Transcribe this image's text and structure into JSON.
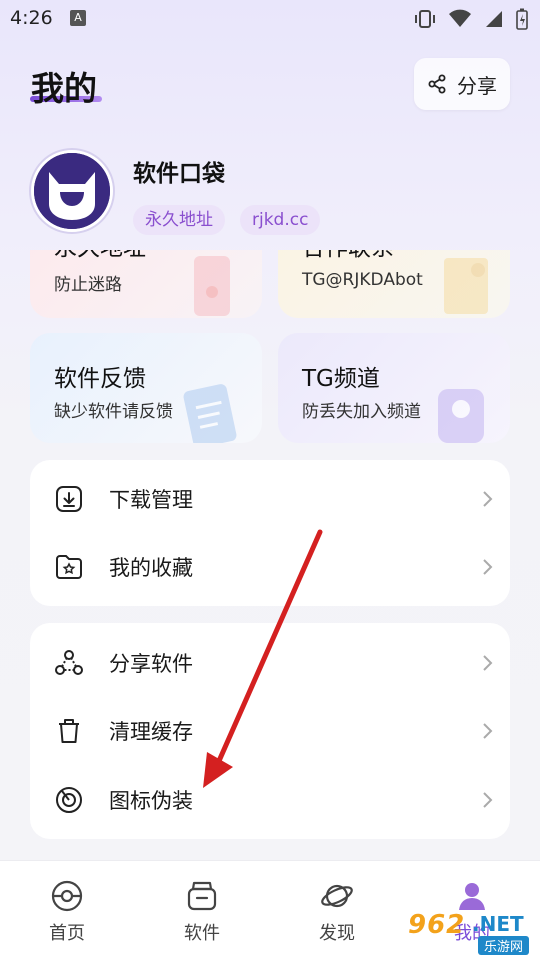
{
  "status": {
    "time": "4:26",
    "notif_letter": "A"
  },
  "header": {
    "title": "我的",
    "share_label": "分享"
  },
  "profile": {
    "name": "软件口袋",
    "tags": [
      "永久地址",
      "rjkd.cc"
    ]
  },
  "top_cards": [
    {
      "title": "永久地址",
      "subtitle": "防止迷路"
    },
    {
      "title": "合作联系",
      "subtitle": "TG@RJKDAbot"
    }
  ],
  "cards": [
    {
      "title": "软件反馈",
      "subtitle": "缺少软件请反馈"
    },
    {
      "title": "TG频道",
      "subtitle": "防丢失加入频道"
    }
  ],
  "list1": [
    {
      "label": "下载管理",
      "icon": "download-icon"
    },
    {
      "label": "我的收藏",
      "icon": "favorite-folder-icon"
    }
  ],
  "list2": [
    {
      "label": "分享软件",
      "icon": "share-nodes-icon"
    },
    {
      "label": "清理缓存",
      "icon": "trash-icon"
    },
    {
      "label": "图标伪装",
      "icon": "disguise-icon"
    }
  ],
  "nav": [
    {
      "label": "首页",
      "icon": "home-icon"
    },
    {
      "label": "软件",
      "icon": "software-icon"
    },
    {
      "label": "发现",
      "icon": "discover-icon"
    },
    {
      "label": "我的",
      "icon": "profile-icon",
      "active": true
    }
  ],
  "watermark": {
    "text": "962",
    "suffix": ".NET",
    "sub": "乐游网"
  },
  "colors": {
    "accent": "#7b4dd8",
    "tag_bg": "#ece3f9",
    "tag_text": "#8a4fcf",
    "arrow": "#d42020"
  }
}
